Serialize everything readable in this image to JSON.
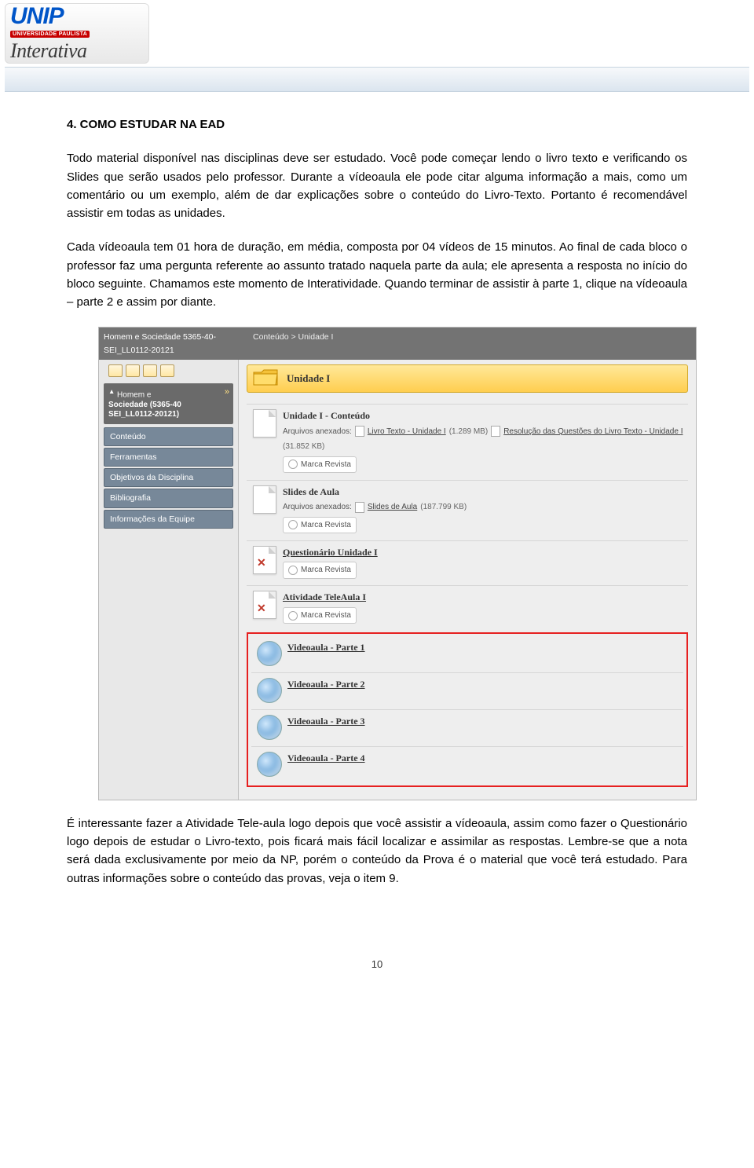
{
  "logo": {
    "brand": "UNIP",
    "badge": "UNIVERSIDADE PAULISTA",
    "sub": "Interativa"
  },
  "doc": {
    "heading": "4. COMO ESTUDAR NA EAD",
    "p1": "Todo material disponível nas disciplinas deve ser estudado. Você pode começar lendo o livro texto e verificando os Slides que serão usados pelo professor. Durante a vídeoaula ele pode citar alguma informação a mais, como um comentário ou um exemplo, além de dar explicações sobre o conteúdo do Livro-Texto. Portanto é recomendável assistir em todas as unidades.",
    "p2": "Cada vídeoaula tem 01 hora de duração, em média, composta por 04 vídeos de 15 minutos. Ao final de cada bloco o professor faz uma pergunta referente ao assunto tratado naquela parte da aula; ele apresenta a resposta no início do bloco seguinte. Chamamos este momento de Interatividade. Quando terminar de assistir à parte 1, clique na vídeoaula – parte 2 e assim por diante.",
    "p3": "É interessante fazer a Atividade Tele-aula logo depois que você assistir a vídeoaula, assim como fazer o Questionário logo depois de estudar o Livro-texto, pois ficará mais fácil localizar e assimilar as respostas. Lembre-se que a nota será dada exclusivamente por meio da NP, porém o conteúdo da Prova é o material que você terá estudado.   Para outras informações sobre o conteúdo das provas, veja o item 9.",
    "pageNumber": "10"
  },
  "ss": {
    "bc_left": "Homem e Sociedade 5365-40-SEI_LL0112-20121",
    "bc_right": "Conteúdo > Unidade I",
    "course1": "Homem e",
    "course2": "Sociedade (5365-40",
    "course3": "SEI_LL0112-20121)",
    "nav": [
      "Conteúdo",
      "Ferramentas",
      "Objetivos da Disciplina",
      "Bibliografia",
      "Informações da Equipe"
    ],
    "title": "Unidade I",
    "marca": "Marca Revista",
    "attach_label": "Arquivos anexados:",
    "item1": {
      "title": "Unidade I - Conteúdo",
      "a1": "Livro Texto - Unidade I",
      "s1": "(1.289 MB)",
      "a2": "Resolução das Questões do Livro Texto - Unidade I",
      "s2": "(31.852 KB)"
    },
    "item2": {
      "title": "Slides de Aula",
      "a1": "Slides de Aula",
      "s1": "(187.799 KB)"
    },
    "item3": {
      "title": "Questionário Unidade I"
    },
    "item4": {
      "title": "Atividade TeleAula I"
    },
    "videos": [
      "Videoaula - Parte 1",
      "Videoaula - Parte 2",
      "Videoaula - Parte 3",
      "Videoaula - Parte 4"
    ]
  }
}
